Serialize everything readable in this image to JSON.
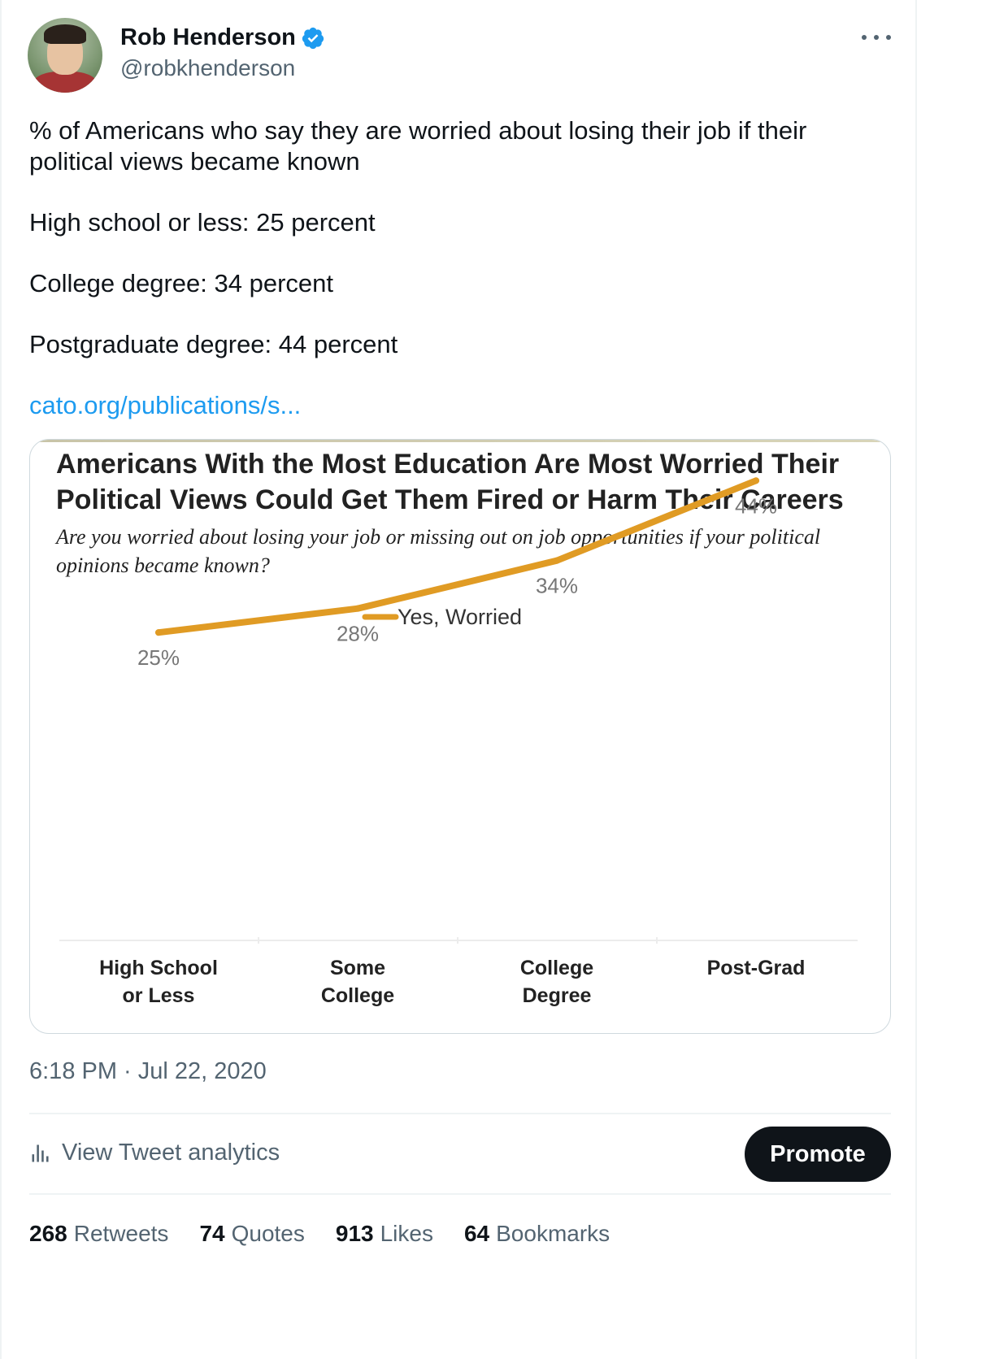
{
  "author": {
    "display_name": "Rob Henderson",
    "handle": "@robkhenderson",
    "verified": true
  },
  "tweet": {
    "text_lines": [
      "% of Americans who say they are worried about losing their job if their political views became known",
      "High school or less: 25 percent",
      "College degree: 34 percent",
      "Postgraduate degree: 44 percent"
    ],
    "link_text": "cato.org/publications/s...",
    "timestamp": "6:18 PM · Jul 22, 2020"
  },
  "chart_data": {
    "type": "line",
    "title": "Americans With the Most Education Are Most Worried Their Political Views Could Get Them Fired or Harm Their Careers",
    "subtitle": "Are you worried about losing your job or missing out on job opportunities if your political opinions became known?",
    "categories": [
      "High School\nor Less",
      "Some\nCollege",
      "College\nDegree",
      "Post-Grad"
    ],
    "series": [
      {
        "name": "Yes, Worried",
        "values": [
          25,
          28,
          34,
          44
        ],
        "color": "#e09b24"
      }
    ],
    "data_labels": [
      "25%",
      "28%",
      "34%",
      "44%"
    ],
    "ylim": [
      0,
      60
    ],
    "legend": "top-center",
    "grid": false
  },
  "actions": {
    "analytics_label": "View Tweet analytics",
    "promote_label": "Promote"
  },
  "stats": [
    {
      "count": "268",
      "label": "Retweets"
    },
    {
      "count": "74",
      "label": "Quotes"
    },
    {
      "count": "913",
      "label": "Likes"
    },
    {
      "count": "64",
      "label": "Bookmarks"
    }
  ],
  "icons": {
    "verified": "verified-badge-icon",
    "more": "more-options-icon",
    "analytics": "bar-chart-icon"
  }
}
